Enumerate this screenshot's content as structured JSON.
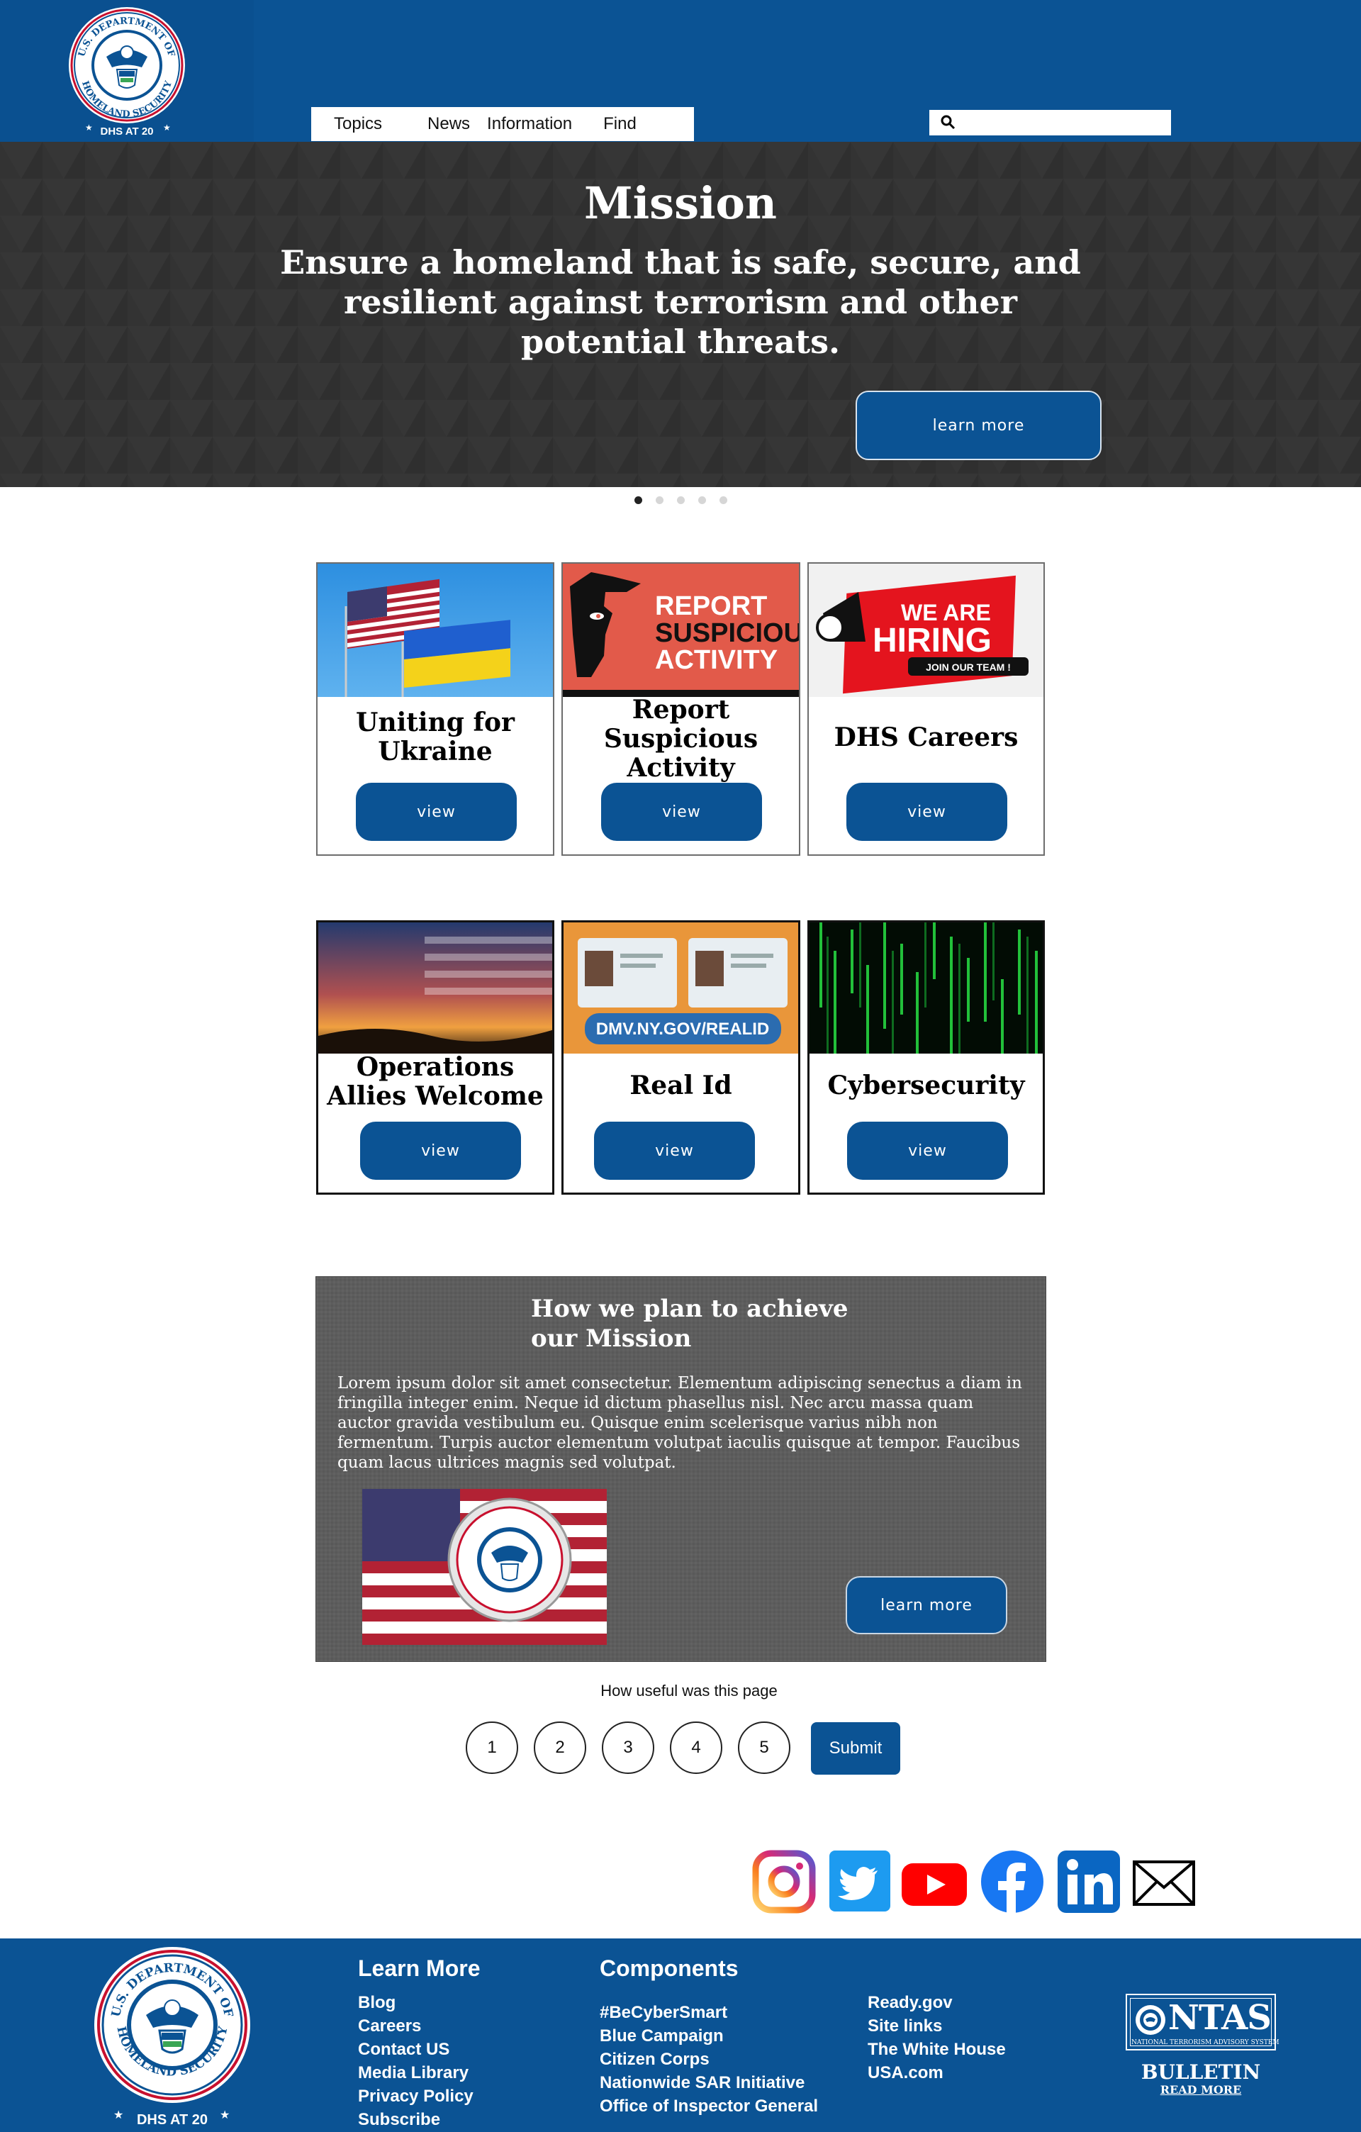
{
  "header": {
    "seal_text_top": "U.S. DEPARTMENT OF",
    "seal_text_bottom": "HOMELAND SECURITY",
    "seal_badge": "DHS AT 20",
    "nav": [
      "Topics",
      "News",
      "Information",
      "Find"
    ],
    "search": {
      "placeholder": "",
      "icon": "search-icon"
    }
  },
  "hero": {
    "title": "Mission",
    "text": "Ensure a homeland that is safe, secure, and resilient against terrorism and other potential threats.",
    "button": "learn more",
    "slides": 5,
    "active_slide": 1
  },
  "cards_row1": [
    {
      "title": "Uniting for Ukraine",
      "button": "view"
    },
    {
      "title": "Report Suspicious Activity",
      "button": "view",
      "image_text": [
        "REPORT",
        "SUSPICIOUS",
        "ACTIVITY"
      ]
    },
    {
      "title": "DHS Careers",
      "button": "view",
      "image_text": [
        "WE ARE",
        "HIRING",
        "JOIN OUR TEAM !"
      ]
    }
  ],
  "cards_row2": [
    {
      "title": "Operations Allies Welcome",
      "button": "view"
    },
    {
      "title": "Real Id",
      "button": "view",
      "image_text": "DMV.NY.GOV/REALID"
    },
    {
      "title": "Cybersecurity",
      "button": "view"
    }
  ],
  "plan": {
    "title": "How we plan to achieve our Mission",
    "text": "Lorem ipsum dolor sit amet consectetur. Elementum adipiscing senectus a diam in fringilla integer enim. Neque id dictum phasellus nisl. Nec arcu massa quam auctor gravida vestibulum eu. Quisque enim scelerisque varius nibh non fermentum. Turpis auctor elementum volutpat iaculis quisque at tempor. Faucibus quam lacus ultrices magnis sed volutpat.",
    "button": "learn more"
  },
  "rating": {
    "question": "How useful was this page",
    "options": [
      "1",
      "2",
      "3",
      "4",
      "5"
    ],
    "submit": "Submit"
  },
  "social": [
    "instagram-icon",
    "twitter-icon",
    "youtube-icon",
    "facebook-icon",
    "linkedin-icon",
    "email-icon"
  ],
  "footer": {
    "learn_more": {
      "heading": "Learn More",
      "links": [
        "Blog",
        "Careers",
        "Contact US",
        "Media Library",
        "Privacy Policy",
        "Subscribe"
      ]
    },
    "components": {
      "heading": "Components",
      "links": [
        "#BeCyberSmart",
        "Blue Campaign",
        "Citizen Corps",
        "Nationwide SAR Initiative",
        "Office of Inspector General"
      ]
    },
    "other_links": [
      "Ready.gov",
      "Site links",
      "The White House",
      "USA.com"
    ],
    "ntas": {
      "name": "NTAS",
      "subtitle": "NATIONAL TERRORISM ADVISORY SYSTEM",
      "bulletin": "BULLETIN",
      "read_more": "READ MORE"
    }
  },
  "colors": {
    "brand_blue": "#0b5394",
    "hero_bg": "#333333",
    "plan_bg": "#5d5d5d"
  }
}
